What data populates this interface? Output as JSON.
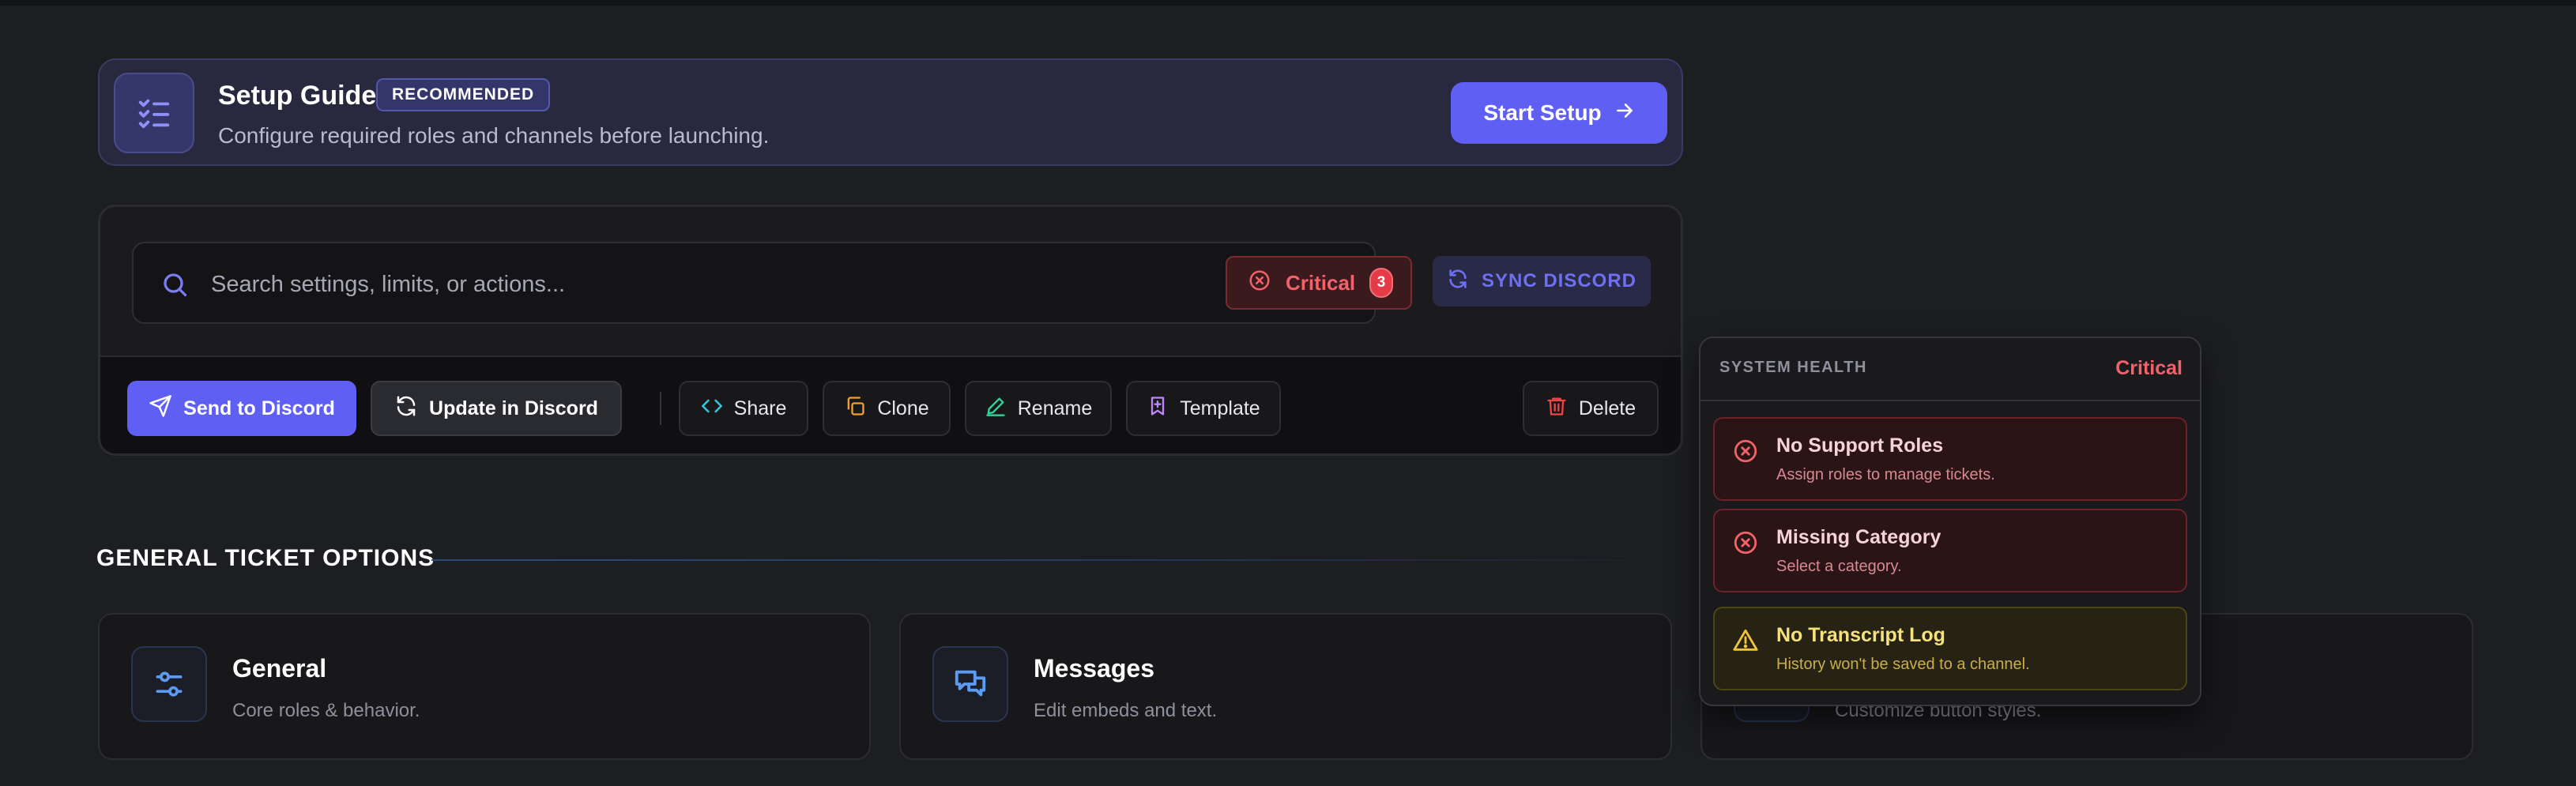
{
  "setup": {
    "title": "Setup Guide",
    "badge": "RECOMMENDED",
    "description": "Configure required roles and channels before launching.",
    "button_label": "Start Setup",
    "icon": "list-checks-icon"
  },
  "toolbar": {
    "search_placeholder": "Search settings, limits, or actions...",
    "shortcut_key": "/",
    "critical_label": "Critical",
    "critical_count": "3",
    "sync_label": "SYNC DISCORD"
  },
  "actions": {
    "send_label": "Send to Discord",
    "update_label": "Update in Discord",
    "share_label": "Share",
    "clone_label": "Clone",
    "rename_label": "Rename",
    "template_label": "Template",
    "delete_label": "Delete"
  },
  "section": {
    "title": "GENERAL TICKET OPTIONS"
  },
  "cards": [
    {
      "title": "General",
      "description": "Core roles & behavior.",
      "icon": "sliders-icon"
    },
    {
      "title": "Messages",
      "description": "Edit embeds and text.",
      "icon": "messages-icon"
    },
    {
      "title": "",
      "description": "Customize button styles.",
      "icon": "button-icon"
    }
  ],
  "health": {
    "label": "SYSTEM HEALTH",
    "status": "Critical",
    "issues": [
      {
        "title": "No Support Roles",
        "description": "Assign roles to manage tickets.",
        "level": "error"
      },
      {
        "title": "Missing Category",
        "description": "Select a category.",
        "level": "error"
      },
      {
        "title": "No Transcript Log",
        "description": "History won't be saved to a channel.",
        "level": "warning"
      }
    ]
  },
  "colors": {
    "accent": "#5f5ff4",
    "critical": "#f2626a",
    "warning": "#f6e27a",
    "background": "#1d1e21"
  }
}
